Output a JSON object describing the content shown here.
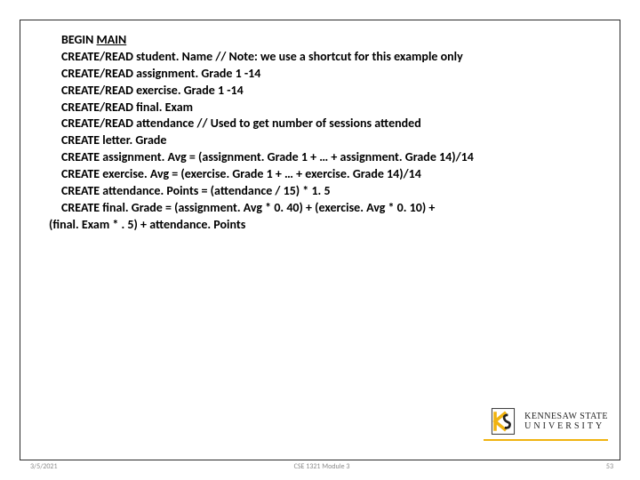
{
  "code": {
    "l1a": "BEGIN ",
    "l1b": "MAIN",
    "l2": "CREATE/READ student. Name    // Note: we use a shortcut for this example only",
    "l3": "CREATE/READ  assignment. Grade 1 -14",
    "l4": "CREATE/READ exercise. Grade 1 -14",
    "l5": "CREATE/READ final. Exam",
    "l6": "CREATE/READ attendance // Used to get number of sessions attended",
    "l7": "CREATE letter. Grade",
    "l8": "CREATE assignment. Avg = (assignment. Grade 1 + … + assignment. Grade 14)/14",
    "l9": "CREATE exercise. Avg = (exercise. Grade 1 + … + exercise. Grade 14)/14",
    "l10": "CREATE attendance. Points = (attendance / 15) * 1. 5",
    "l11": "CREATE final. Grade =  (assignment. Avg * 0. 40) + (exercise. Avg * 0. 10) +",
    "l12": "(final. Exam * . 5) + attendance. Points"
  },
  "logo": {
    "line1": "KENNESAW STATE",
    "line2": "UNIVERSITY"
  },
  "footer": {
    "date": "3/5/2021",
    "course": "CSE 1321 Module 3",
    "page": "53"
  }
}
